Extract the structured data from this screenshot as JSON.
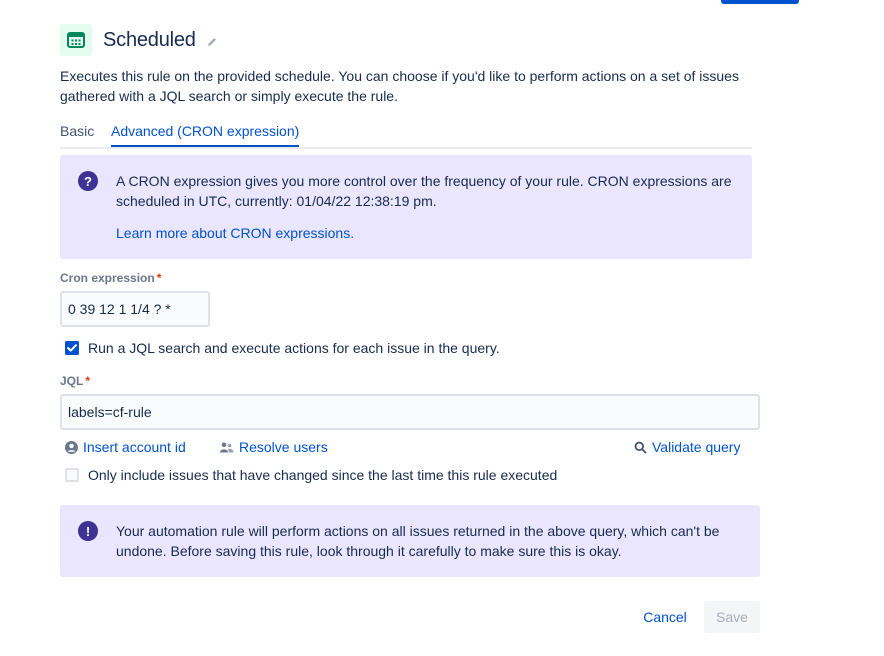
{
  "header": {
    "title": "Scheduled",
    "icon": "calendar-icon",
    "edit_icon": "pencil-icon"
  },
  "description": "Executes this rule on the provided schedule. You can choose if you'd like to perform actions on a set of issues gathered with a JQL search or simply execute the rule.",
  "tabs": [
    {
      "label": "Basic",
      "active": false
    },
    {
      "label": "Advanced (CRON expression)",
      "active": true
    }
  ],
  "info_panel": {
    "icon": "question-icon",
    "text": "A CRON expression gives you more control over the frequency of your rule. CRON expressions are scheduled in UTC, currently: 01/04/22 12:38:19 pm.",
    "link": "Learn more about CRON expressions."
  },
  "cron": {
    "label": "Cron expression",
    "required_mark": "*",
    "value": "0 39 12 1 1/4 ? *"
  },
  "run_jql_checkbox": {
    "label": "Run a JQL search and execute actions for each issue in the query.",
    "checked": true
  },
  "jql": {
    "label": "JQL",
    "required_mark": "*",
    "value": "labels=cf-rule"
  },
  "jql_links": {
    "insert_account": "Insert account id",
    "resolve_users": "Resolve users",
    "validate_query": "Validate query"
  },
  "only_changed_checkbox": {
    "label": "Only include issues that have changed since the last time this rule executed",
    "checked": false
  },
  "warning_panel": {
    "icon": "exclamation-icon",
    "text": "Your automation rule will perform actions on all issues returned in the above query, which can't be undone. Before saving this rule, look through it carefully to make sure this is okay."
  },
  "buttons": {
    "cancel": "Cancel",
    "save": "Save"
  },
  "colors": {
    "primary": "#0052cc",
    "panel_bg": "#eae6ff",
    "panel_icon": "#403294",
    "required": "#de350b",
    "trigger_icon_bg": "#e3fcef",
    "trigger_icon": "#00875a"
  }
}
